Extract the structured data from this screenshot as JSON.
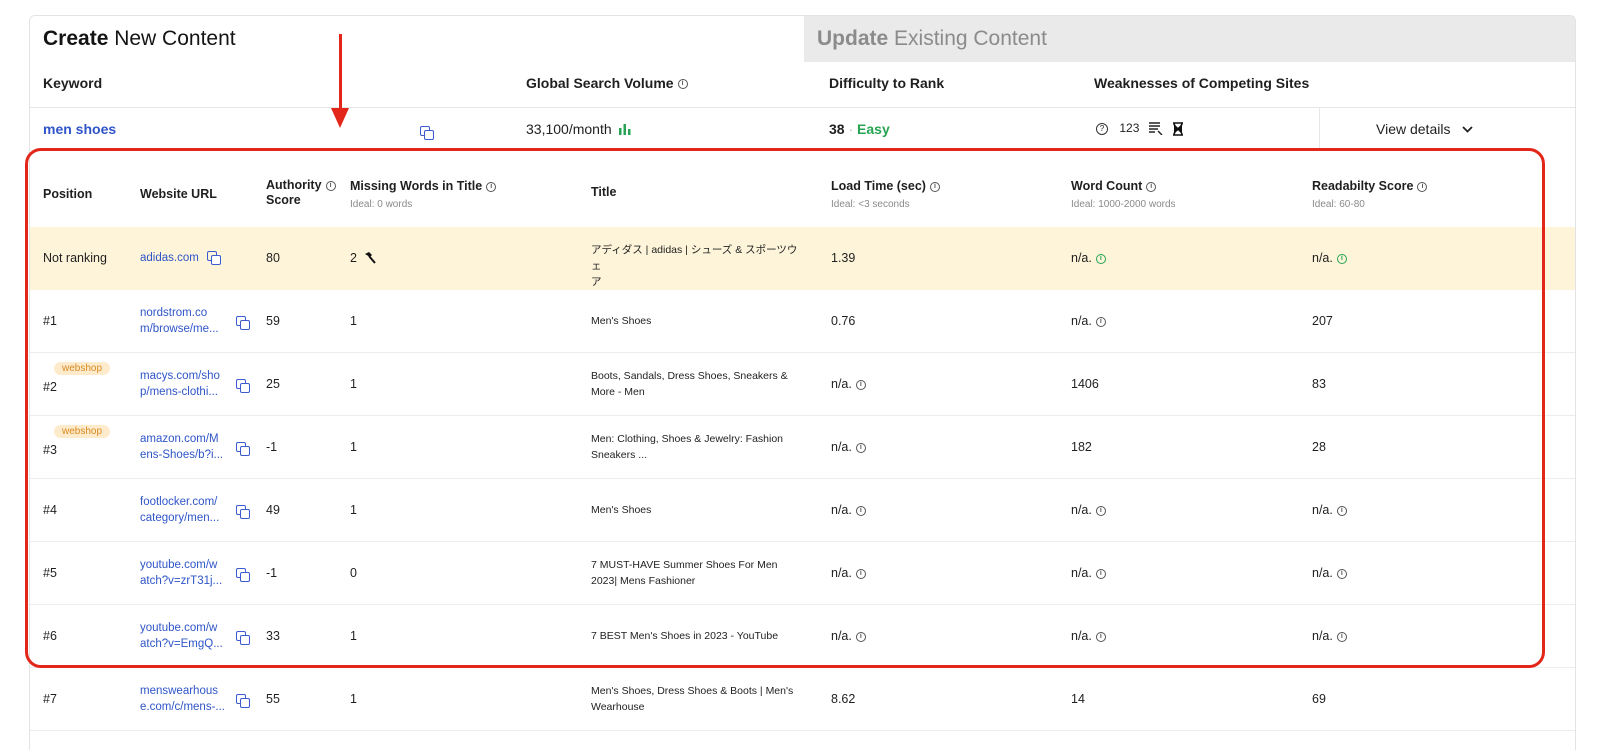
{
  "tabs": {
    "create_bold": "Create",
    "create_rest": " New Content",
    "update_bold": "Update",
    "update_rest": " Existing Content"
  },
  "keyword_header": {
    "keyword": "Keyword",
    "volume": "Global Search Volume",
    "difficulty": "Difficulty to Rank",
    "weaknesses": "Weaknesses of Competing Sites"
  },
  "keyword_row": {
    "keyword": "men shoes",
    "volume": "33,100/month",
    "difficulty_value": "38",
    "difficulty_sep": "·",
    "difficulty_label": "Easy",
    "weakness_count": "123",
    "view_details": "View details"
  },
  "table_header": {
    "position": "Position",
    "url": "Website URL",
    "authority": "Authority",
    "authority2": "Score",
    "missing": "Missing Words in Title",
    "missing_sub": "Ideal: 0 words",
    "title": "Title",
    "load": "Load Time (sec)",
    "load_sub": "Ideal: <3 seconds",
    "words": "Word Count",
    "words_sub": "Ideal: 1000-2000 words",
    "read": "Readabilty Score",
    "read_sub": "Ideal: 60-80"
  },
  "rows": [
    {
      "position": "Not ranking",
      "url1": "adidas.com",
      "url2": "",
      "authority": "80",
      "missing": "2",
      "title1": "アディダス | adidas | シューズ & スポーツウェ",
      "title2": "ア",
      "load": "1.39",
      "words": "n/a.",
      "read": "n/a."
    },
    {
      "position": "#1",
      "url1": "nordstrom.co",
      "url2": "m/browse/me...",
      "authority": "59",
      "missing": "1",
      "title1": "Men's Shoes",
      "title2": "",
      "load": "0.76",
      "words": "n/a.",
      "read": "207"
    },
    {
      "position": "#2",
      "badge": "webshop",
      "url1": "macys.com/sho",
      "url2": "p/mens-clothi...",
      "authority": "25",
      "missing": "1",
      "title1": "Boots, Sandals, Dress Shoes, Sneakers &",
      "title2": "More - Men",
      "load": "n/a.",
      "words": "1406",
      "read": "83"
    },
    {
      "position": "#3",
      "badge": "webshop",
      "url1": "amazon.com/M",
      "url2": "ens-Shoes/b?i...",
      "authority": "-1",
      "missing": "1",
      "title1": "Men: Clothing, Shoes & Jewelry: Fashion",
      "title2": "Sneakers ...",
      "load": "n/a.",
      "words": "182",
      "read": "28"
    },
    {
      "position": "#4",
      "url1": "footlocker.com/",
      "url2": "category/men...",
      "authority": "49",
      "missing": "1",
      "title1": "Men's Shoes",
      "title2": "",
      "load": "n/a.",
      "words": "n/a.",
      "read": "n/a."
    },
    {
      "position": "#5",
      "url1": "youtube.com/w",
      "url2": "atch?v=zrT31j...",
      "authority": "-1",
      "missing": "0",
      "title1": "7 MUST-HAVE Summer Shoes For Men",
      "title2": "2023| Mens Fashioner",
      "load": "n/a.",
      "words": "n/a.",
      "read": "n/a."
    },
    {
      "position": "#6",
      "url1": "youtube.com/w",
      "url2": "atch?v=EmgQ...",
      "authority": "33",
      "missing": "1",
      "title1": "7 BEST Men's Shoes in 2023 - YouTube",
      "title2": "",
      "load": "n/a.",
      "words": "n/a.",
      "read": "n/a."
    },
    {
      "position": "#7",
      "url1": "menswearhous",
      "url2": "e.com/c/mens-...",
      "authority": "55",
      "missing": "1",
      "title1": "Men's Shoes, Dress Shoes & Boots | Men's",
      "title2": "Wearhouse",
      "load": "8.62",
      "words": "14",
      "read": "69"
    }
  ],
  "colors": {
    "accent": "#2f55c8",
    "good": "#27a453",
    "bad": "#d83636",
    "annotation": "#e3261a"
  }
}
